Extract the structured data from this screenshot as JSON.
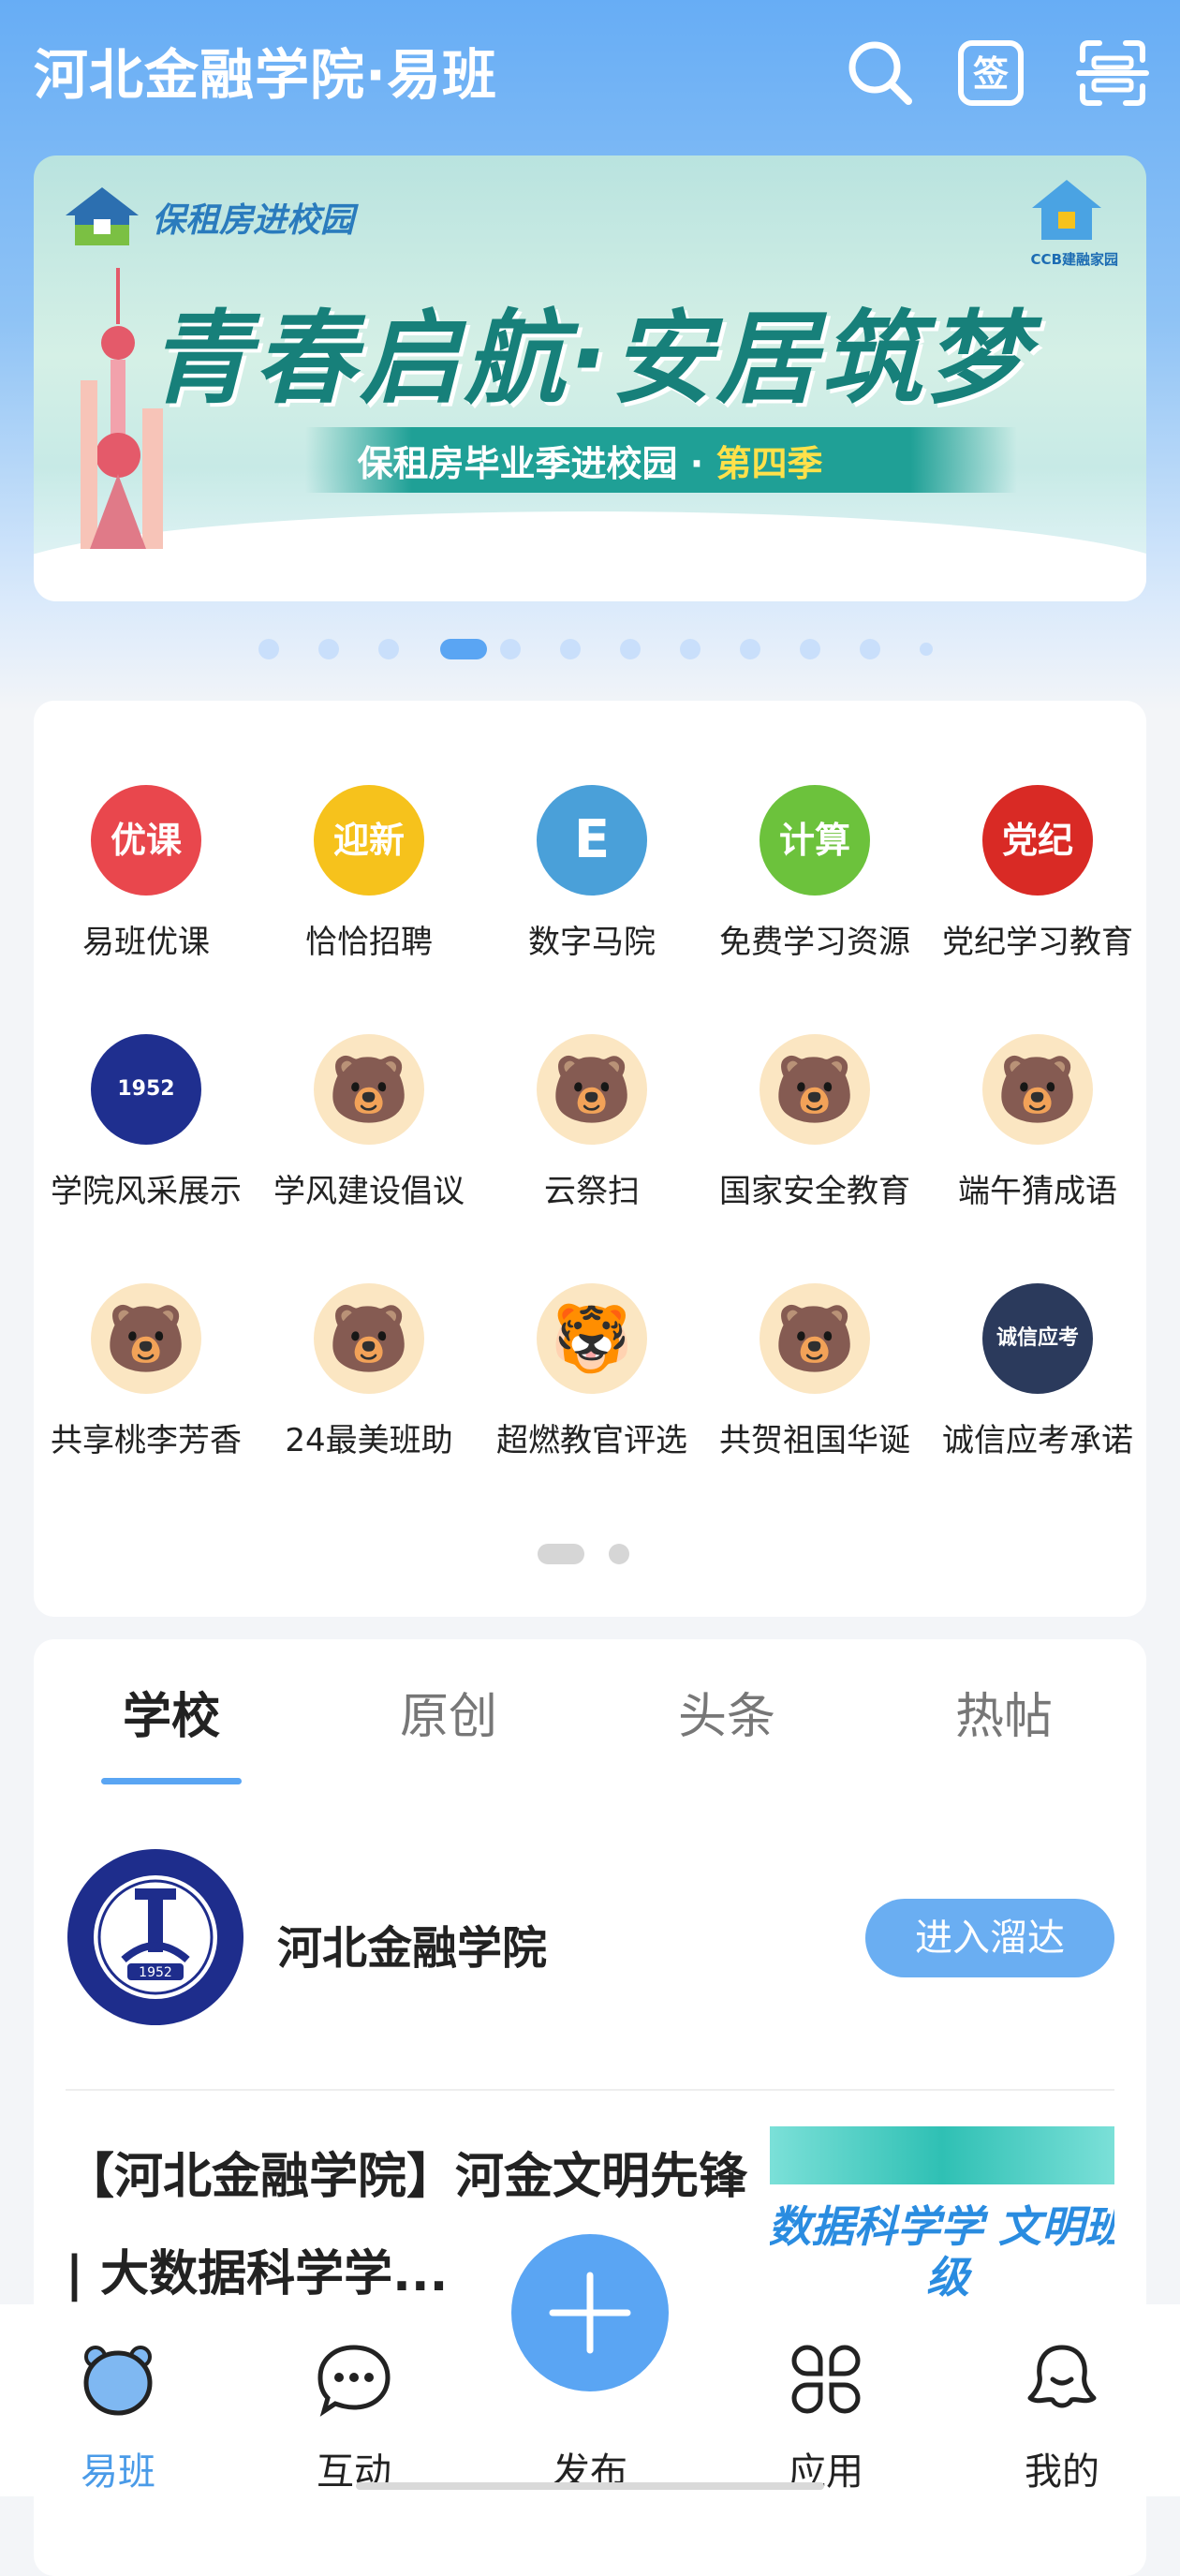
{
  "header": {
    "title": "河北金融学院·易班",
    "icons": [
      "search-icon",
      "sign-in-icon",
      "scan-icon"
    ]
  },
  "banner": {
    "tag": "保租房进校园",
    "headline": "青春启航·安居筑梦",
    "subtitle_prefix": "保租房毕业季进校园 · ",
    "subtitle_season": "第四季",
    "brand": "CCB建融家园",
    "carousel_total": 12,
    "carousel_active": 4
  },
  "apps": [
    {
      "label": "易班优课",
      "icon": "yooc-icon",
      "glyph": "优课",
      "color": "#e9474d"
    },
    {
      "label": "恰恰招聘",
      "icon": "recruit-icon",
      "glyph": "迎新",
      "color": "#f6c21c"
    },
    {
      "label": "数字马院",
      "icon": "digital-cube-icon",
      "glyph": "E",
      "color": "#4aa0d9"
    },
    {
      "label": "免费学习资源",
      "icon": "study-resources-icon",
      "glyph": "计算",
      "color": "#6cc23c"
    },
    {
      "label": "党纪学习教育",
      "icon": "party-discipline-icon",
      "glyph": "党纪",
      "color": "#d92a25"
    },
    {
      "label": "学院风采展示",
      "icon": "university-seal-icon",
      "glyph": "1952",
      "color": "#1f2f8f"
    },
    {
      "label": "学风建设倡议",
      "icon": "bear-mascot-icon",
      "glyph": "🐻",
      "color": "#fbe6c2"
    },
    {
      "label": "云祭扫",
      "icon": "bear-soldier-icon",
      "glyph": "🐻",
      "color": "#fbe6c2"
    },
    {
      "label": "国家安全教育",
      "icon": "bear-mascot-icon",
      "glyph": "🐻",
      "color": "#fbe6c2"
    },
    {
      "label": "端午猜成语",
      "icon": "bear-mascot-icon",
      "glyph": "🐻",
      "color": "#fbe6c2"
    },
    {
      "label": "共享桃李芳香",
      "icon": "bear-mascot-icon",
      "glyph": "🐻",
      "color": "#fbe6c2"
    },
    {
      "label": "24最美班助",
      "icon": "bear-glasses-icon",
      "glyph": "🐻",
      "color": "#fbe6c2"
    },
    {
      "label": "超燃教官评选",
      "icon": "tiger-soldier-icon",
      "glyph": "🐯",
      "color": "#fbe6c2"
    },
    {
      "label": "共贺祖国华诞",
      "icon": "bear-flag-icon",
      "glyph": "🐻",
      "color": "#fbe6c2"
    },
    {
      "label": "诚信应考承诺",
      "icon": "integrity-exam-icon",
      "glyph": "诚信应考",
      "color": "#2b3a5c"
    }
  ],
  "tabs": [
    "学校",
    "原创",
    "头条",
    "热帖"
  ],
  "active_tab": 0,
  "school": {
    "name": "河北金融学院",
    "enter_button": "进入溜达",
    "seal_year": "1952"
  },
  "article": {
    "title": "【河北金融学院】河金文明先锋 | 大数据科学学...",
    "thumb_text": "数据科学学 文明班级"
  },
  "bottom_nav": [
    {
      "label": "易班",
      "icon": "bear-home-icon",
      "active": true
    },
    {
      "label": "互动",
      "icon": "chat-bubble-icon",
      "active": false
    },
    {
      "label": "发布",
      "icon": "plus-icon",
      "active": false
    },
    {
      "label": "应用",
      "icon": "apps-grid-icon",
      "active": false
    },
    {
      "label": "我的",
      "icon": "profile-icon",
      "active": false
    }
  ],
  "colors": {
    "accent": "#5aa5f3",
    "header_bg": "#67adf5"
  }
}
